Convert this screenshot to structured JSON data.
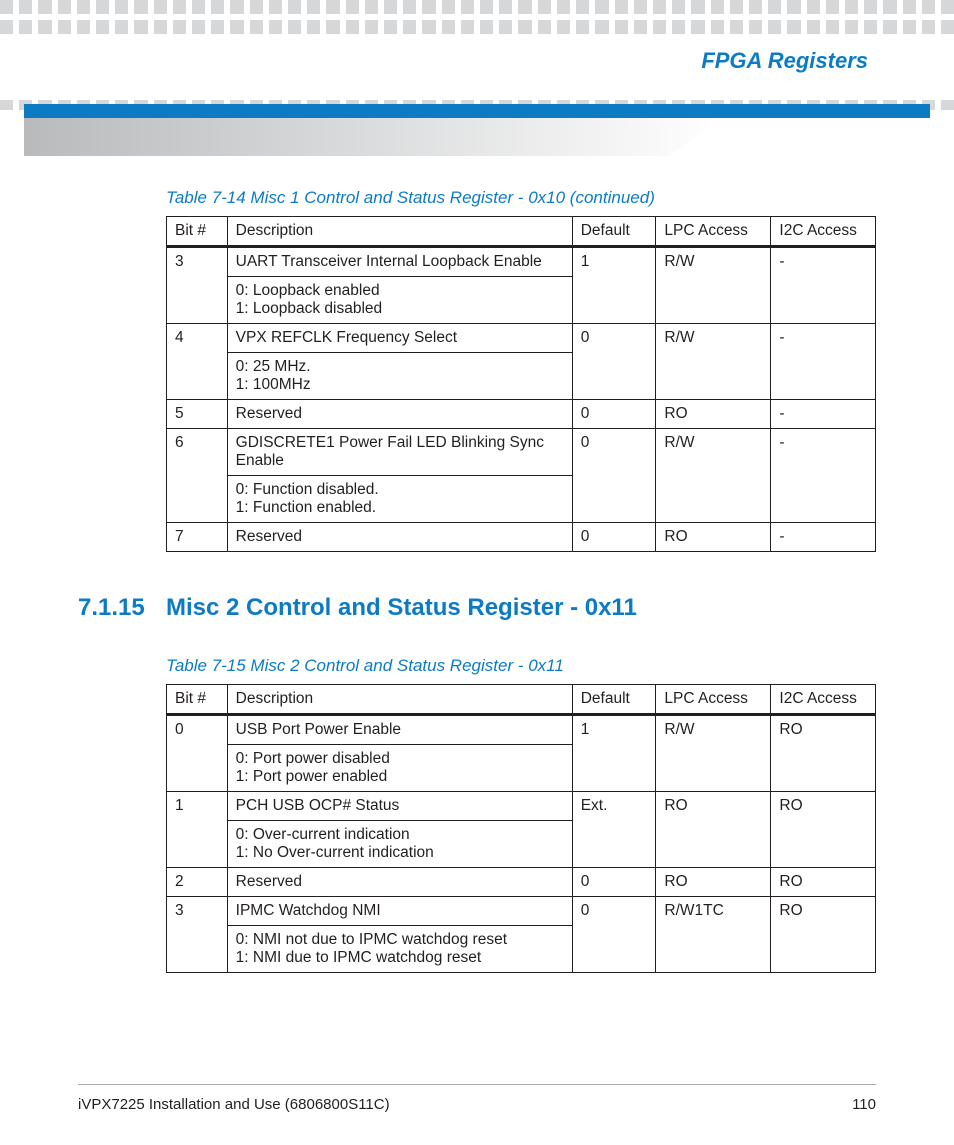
{
  "header": {
    "title": "FPGA Registers"
  },
  "table1": {
    "caption": "Table 7-14 Misc 1 Control and Status Register - 0x10 (continued)",
    "headers": {
      "bit": "Bit #",
      "desc": "Description",
      "def": "Default",
      "lpc": "LPC Access",
      "i2c": "I2C Access"
    },
    "rows": [
      {
        "bit": "3",
        "desc": "UART Transceiver Internal Loopback Enable",
        "def": "1",
        "lpc": "R/W",
        "i2c": "-",
        "sub": "0: Loopback enabled\n1: Loopback disabled"
      },
      {
        "bit": "4",
        "desc": "VPX REFCLK Frequency Select",
        "def": "0",
        "lpc": "R/W",
        "i2c": "-",
        "sub": "0: 25 MHz.\n1: 100MHz"
      },
      {
        "bit": "5",
        "desc": "Reserved",
        "def": "0",
        "lpc": "RO",
        "i2c": "-"
      },
      {
        "bit": "6",
        "desc": "GDISCRETE1 Power Fail LED Blinking Sync Enable",
        "def": "0",
        "lpc": "R/W",
        "i2c": "-",
        "sub": "0: Function disabled.\n1: Function enabled."
      },
      {
        "bit": "7",
        "desc": "Reserved",
        "def": "0",
        "lpc": "RO",
        "i2c": "-"
      }
    ]
  },
  "section": {
    "number": "7.1.15",
    "title": "Misc 2 Control and Status Register - 0x11"
  },
  "table2": {
    "caption": "Table 7-15 Misc 2 Control and Status Register - 0x11",
    "headers": {
      "bit": "Bit #",
      "desc": "Description",
      "def": "Default",
      "lpc": "LPC Access",
      "i2c": "I2C Access"
    },
    "rows": [
      {
        "bit": "0",
        "desc": "USB Port Power Enable",
        "def": "1",
        "lpc": "R/W",
        "i2c": "RO",
        "sub": "0: Port power disabled\n1: Port power enabled"
      },
      {
        "bit": "1",
        "desc": "PCH USB OCP# Status",
        "def": "Ext.",
        "lpc": "RO",
        "i2c": "RO",
        "sub": "0: Over-current indication\n1: No Over-current indication"
      },
      {
        "bit": "2",
        "desc": "Reserved",
        "def": "0",
        "lpc": "RO",
        "i2c": "RO"
      },
      {
        "bit": "3",
        "desc": "IPMC Watchdog NMI",
        "def": "0",
        "lpc": "R/W1TC",
        "i2c": "RO",
        "sub": "0: NMI not due to IPMC watchdog reset\n1: NMI due to IPMC watchdog reset"
      }
    ]
  },
  "footer": {
    "left": "iVPX7225 Installation and Use (6806800S11C)",
    "right": "110"
  }
}
